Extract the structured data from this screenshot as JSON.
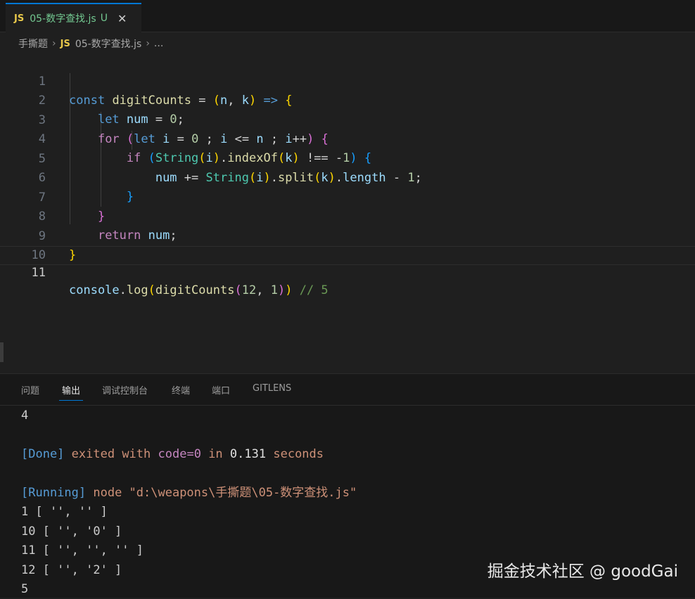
{
  "tab": {
    "badge": "JS",
    "filename": "05-数字查找.js",
    "status": "U",
    "close": "✕"
  },
  "breadcrumb": {
    "folder": "手撕题",
    "badge": "JS",
    "file": "05-数字查找.js",
    "more": "..."
  },
  "editor": {
    "line_numbers": [
      "1",
      "2",
      "3",
      "4",
      "5",
      "6",
      "7",
      "8",
      "9",
      "10",
      "11"
    ],
    "current_line": 11
  },
  "panel": {
    "tabs": [
      "问题",
      "输出",
      "调试控制台",
      "终端",
      "端口",
      "GITLENS"
    ],
    "active_tab": "输出"
  },
  "output": {
    "line1": "4",
    "done_tag": "[Done]",
    "done_exited": "exited with",
    "done_code": "code=0",
    "done_in": "in",
    "done_time": "0.131",
    "done_seconds": "seconds",
    "running_tag": "[Running]",
    "running_cmd": "node \"d:\\weapons\\手撕题\\05-数字查找.js\"",
    "results": [
      "1 [ '', '' ]",
      "10 [ '', '0' ]",
      "11 [ '', '', '' ]",
      "12 [ '', '2' ]",
      "5"
    ]
  },
  "watermark": "掘金技术社区 @ goodGai"
}
